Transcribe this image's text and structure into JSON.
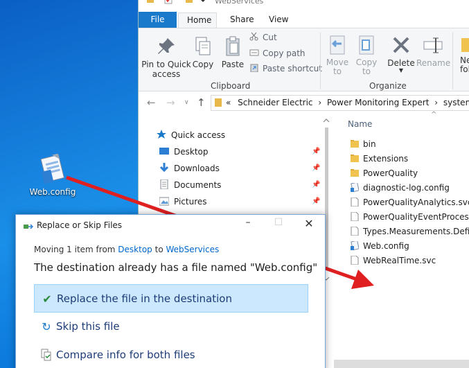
{
  "desktop": {
    "icon_label": "Web.config"
  },
  "explorer": {
    "title": "WebServices",
    "tabs": {
      "file": "File",
      "home": "Home",
      "share": "Share",
      "view": "View"
    },
    "ribbon": {
      "pin_quick_access": "Pin to Quick\naccess",
      "copy": "Copy",
      "paste": "Paste",
      "cut": "Cut",
      "copy_path": "Copy path",
      "paste_shortcut": "Paste shortcut",
      "clipboard_group": "Clipboard",
      "move_to": "Move\nto",
      "copy_to": "Copy\nto",
      "delete": "Delete",
      "rename": "Rename",
      "organize_group": "Organize",
      "new_folder_partial": "Ne\nfol"
    },
    "address": {
      "prefix": "«",
      "segments": [
        "Schneider Electric",
        "Power Monitoring Expert",
        "system"
      ],
      "trailing": "›"
    },
    "nav": {
      "quick_access": "Quick access",
      "items": [
        "Desktop",
        "Downloads",
        "Documents",
        "Pictures"
      ]
    },
    "files": {
      "column_name": "Name",
      "items": [
        {
          "name": "bin",
          "type": "folder"
        },
        {
          "name": "Extensions",
          "type": "folder"
        },
        {
          "name": "PowerQuality",
          "type": "folder"
        },
        {
          "name": "diagnostic-log.config",
          "type": "config"
        },
        {
          "name": "PowerQualityAnalytics.svc",
          "type": "file"
        },
        {
          "name": "PowerQualityEventProcessor.",
          "type": "file"
        },
        {
          "name": "Types.Measurements.Definitio",
          "type": "file"
        },
        {
          "name": "Web.config",
          "type": "config"
        },
        {
          "name": "WebRealTime.svc",
          "type": "file"
        }
      ]
    }
  },
  "dialog": {
    "title": "Replace or Skip Files",
    "moving_prefix": "Moving 1 item from ",
    "source": "Desktop",
    "moving_to": " to ",
    "target": "WebServices",
    "message": "The destination already has a file named \"Web.config\"",
    "options": [
      {
        "label": "Replace the file in the destination",
        "icon": "check-icon"
      },
      {
        "label": "Skip this file",
        "icon": "skip-icon"
      },
      {
        "label": "Compare info for both files",
        "icon": "compare-icon"
      }
    ]
  },
  "colors": {
    "accent": "#1979ca",
    "arrow": "#e02020",
    "selection": "#cce8ff"
  }
}
